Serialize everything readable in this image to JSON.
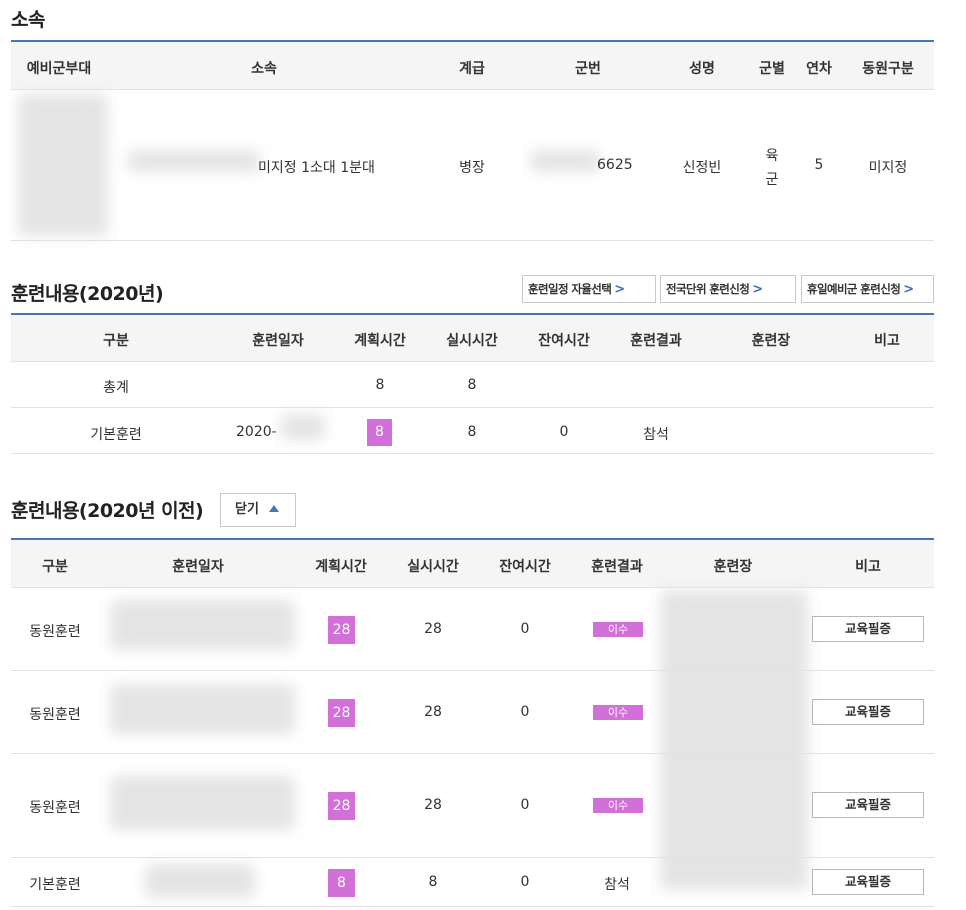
{
  "affiliation": {
    "title": "소속",
    "headers": [
      "예비군부대",
      "소속",
      "계급",
      "군번",
      "성명",
      "군별",
      "연차",
      "동원구분"
    ],
    "row": {
      "unit_suffix": "미지정 1소대 1분대",
      "rank": "병장",
      "service_number_suffix": "6625",
      "name": "신정빈",
      "branch_top": "육",
      "branch_bottom": "군",
      "year": "5",
      "mobilization": "미지정"
    }
  },
  "training_2020": {
    "title": "훈련내용(2020년)",
    "buttons": [
      "훈련일정 자율선택",
      "전국단위 훈련신청",
      "휴일예비군 훈련신청"
    ],
    "headers": [
      "구분",
      "훈련일자",
      "계획시간",
      "실시시간",
      "잔여시간",
      "훈련결과",
      "훈련장",
      "비고"
    ],
    "rows": [
      {
        "type": "총계",
        "date": "",
        "planned": "8",
        "actual": "8",
        "remaining": "",
        "result": "",
        "site": "",
        "note": ""
      },
      {
        "type": "기본훈련",
        "date": "2020-",
        "planned": "8",
        "actual": "8",
        "remaining": "0",
        "result": "참석",
        "site": "",
        "note": ""
      }
    ]
  },
  "training_before": {
    "title": "훈련내용(2020년 이전)",
    "close_label": "닫기",
    "headers": [
      "구분",
      "훈련일자",
      "계획시간",
      "실시시간",
      "잔여시간",
      "훈련결과",
      "훈련장",
      "비고"
    ],
    "rows": [
      {
        "type": "동원훈련",
        "planned": "28",
        "actual": "28",
        "remaining": "0",
        "result": "이수",
        "button": "교육필증"
      },
      {
        "type": "동원훈련",
        "planned": "28",
        "actual": "28",
        "remaining": "0",
        "result": "이수",
        "button": "교육필증"
      },
      {
        "type": "동원훈련",
        "planned": "28",
        "actual": "28",
        "remaining": "0",
        "result": "이수",
        "button": "교육필증"
      },
      {
        "type": "기본훈련",
        "planned": "8",
        "actual": "8",
        "remaining": "0",
        "result": "참석",
        "button": "교육필증"
      }
    ]
  },
  "colors": {
    "accent_blue": "#4a74b8",
    "highlight_pink": "#d26fd8",
    "header_bg": "#f5f5f5"
  }
}
